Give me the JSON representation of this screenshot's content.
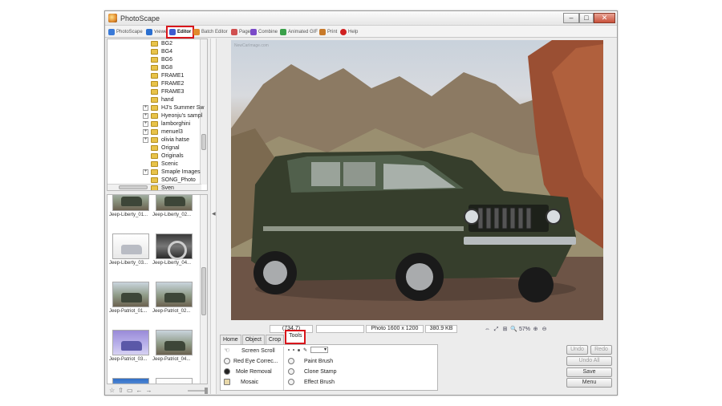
{
  "window": {
    "title": "PhotoScape"
  },
  "tabs": [
    {
      "label": "PhotoScape",
      "color": "#3a7ad8"
    },
    {
      "label": "Viewer",
      "color": "#2a6fd0"
    },
    {
      "label": "Editor",
      "color": "#3f5bd0"
    },
    {
      "label": "Batch Editor",
      "color": "#e08a2c"
    },
    {
      "label": "Page",
      "color": "#d05050"
    },
    {
      "label": "Combine",
      "color": "#7a4ac8"
    },
    {
      "label": "Animated GIF",
      "color": "#3aa04a"
    },
    {
      "label": "Print",
      "color": "#c87a2a"
    },
    {
      "label": "Help",
      "color": "#d02020"
    }
  ],
  "tree": {
    "items": [
      {
        "label": "BG2",
        "expand": false
      },
      {
        "label": "BG4",
        "expand": false
      },
      {
        "label": "BG6",
        "expand": false
      },
      {
        "label": "BG8",
        "expand": false
      },
      {
        "label": "FRAME1",
        "expand": false
      },
      {
        "label": "FRAME2",
        "expand": false
      },
      {
        "label": "FRAME3",
        "expand": false
      },
      {
        "label": "hand",
        "expand": false
      },
      {
        "label": "HJ's Summer Sw",
        "expand": true
      },
      {
        "label": "Hyeonju's sampl",
        "expand": true
      },
      {
        "label": "lamborghini",
        "expand": true
      },
      {
        "label": "menuel3",
        "expand": true
      },
      {
        "label": "olivia hatse",
        "expand": true
      },
      {
        "label": "Orignal",
        "expand": false
      },
      {
        "label": "Originals",
        "expand": false
      },
      {
        "label": "Scenic",
        "expand": false
      },
      {
        "label": "Smaple Images",
        "expand": true
      },
      {
        "label": "SONG_Photo",
        "expand": false
      },
      {
        "label": "Sven",
        "expand": false
      }
    ]
  },
  "thumbnails": [
    {
      "caption": "Jeep-Liberty_01...",
      "style": ""
    },
    {
      "caption": "Jeep-Liberty_02...",
      "style": ""
    },
    {
      "caption": "Jeep-Liberty_03...",
      "style": "white"
    },
    {
      "caption": "Jeep-Liberty_04...",
      "style": "interior"
    },
    {
      "caption": "Jeep-Patriot_01...",
      "style": ""
    },
    {
      "caption": "Jeep-Patriot_02...",
      "style": ""
    },
    {
      "caption": "Jeep-Patriot_03...",
      "style": "purple"
    },
    {
      "caption": "Jeep-Patriot_04...",
      "style": ""
    },
    {
      "caption": "",
      "style": "blue"
    },
    {
      "caption": "",
      "style": "white"
    }
  ],
  "image": {
    "watermark": "NewCarImage.com"
  },
  "status": {
    "coords": "(734,7)",
    "blank": "",
    "info": "Photo 1600 x 1200",
    "size": "380.9 KB",
    "zoom": "57%"
  },
  "bottom_tabs": [
    "Home",
    "Object",
    "Crop",
    "Tools"
  ],
  "tools": {
    "left": [
      "Screen Scroll",
      "Red Eye Correc...",
      "Mole Removal",
      "Mosaic"
    ],
    "right": [
      "Paint Brush",
      "Clone Stamp",
      "Effect Brush"
    ]
  },
  "buttons": {
    "undo": "Undo",
    "redo": "Redo",
    "undo_all": "Undo All",
    "save": "Save",
    "menu": "Menu"
  }
}
